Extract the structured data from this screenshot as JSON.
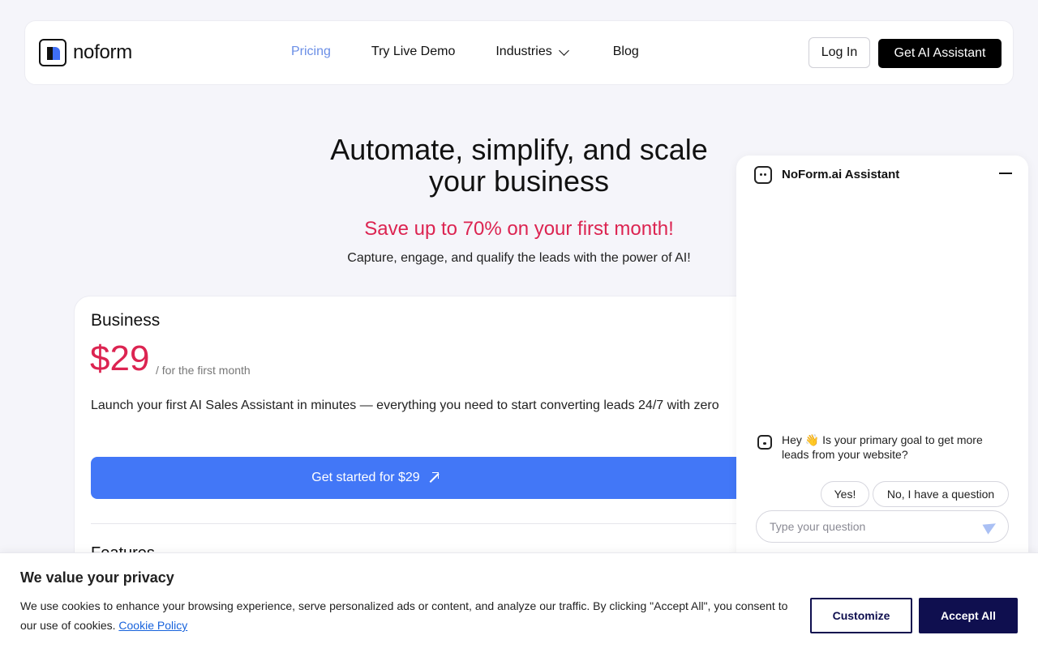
{
  "header": {
    "logo_text": "noform",
    "nav": {
      "pricing": "Pricing",
      "demo": "Try Live Demo",
      "industries": "Industries",
      "blog": "Blog"
    },
    "login_label": "Log In",
    "cta_label": "Get AI Assistant"
  },
  "hero": {
    "title_line1": "Automate, simplify, and scale",
    "title_line2": "your business",
    "save_text": "Save up to 70% on your first month!",
    "subtitle": "Capture, engage, and qualify the leads with the power of AI!"
  },
  "plan": {
    "name": "Business",
    "price": "$29",
    "price_note": "/ for the first month",
    "description": "Launch your first AI Sales Assistant in minutes — everything you need to start converting leads 24/7  with zero",
    "cta_label": "Get started for $29",
    "features_heading": "Features"
  },
  "chat": {
    "title": "NoForm.ai Assistant",
    "message": "Hey 👋 Is your primary goal to get more leads from your website?",
    "reply_yes": "Yes!",
    "reply_no": "No, I have a question",
    "input_placeholder": "Type your question"
  },
  "cookie": {
    "title": "We value your privacy",
    "text": "We use cookies to enhance your browsing experience, serve personalized ads or content, and analyze our traffic. By clicking \"Accept All\", you consent to our use of cookies.",
    "policy_link": "Cookie Policy",
    "customize_label": "Customize",
    "accept_label": "Accept All"
  },
  "colors": {
    "accent_blue": "#4277f7",
    "highlight_red": "#dc2451",
    "nav_active": "#6a8ee6",
    "cookie_navy": "#0f0f4f"
  }
}
